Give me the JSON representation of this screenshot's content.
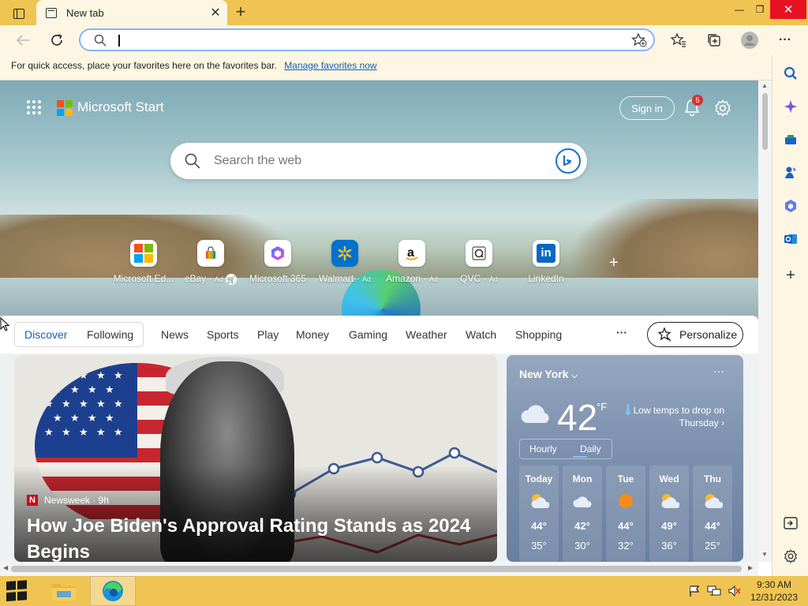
{
  "browser": {
    "tab_title": "New tab",
    "address_value": "",
    "favorites_bar_text": "For quick access, place your favorites here on the favorites bar.",
    "favorites_bar_link": "Manage favorites now"
  },
  "page": {
    "brand": "Microsoft Start",
    "sign_in": "Sign in",
    "notification_count": "5",
    "search_placeholder": "Search the web",
    "quick_links": [
      {
        "label": "Microsoft Ed...",
        "ad": "",
        "icon": "microsoft-logo-icon"
      },
      {
        "label": "eBay",
        "ad": "Ad",
        "icon": "ebay-bag-icon"
      },
      {
        "label": "Microsoft 365",
        "ad": "",
        "icon": "microsoft-365-icon"
      },
      {
        "label": "Walmart",
        "ad": "Ad",
        "icon": "walmart-icon"
      },
      {
        "label": "Amazon",
        "ad": "Ad",
        "icon": "amazon-icon"
      },
      {
        "label": "QVC",
        "ad": "Ad",
        "icon": "qvc-icon"
      },
      {
        "label": "LinkedIn",
        "ad": "",
        "icon": "linkedin-icon"
      }
    ],
    "nav": [
      "Discover",
      "Following",
      "News",
      "Sports",
      "Play",
      "Money",
      "Gaming",
      "Weather",
      "Watch",
      "Shopping"
    ],
    "nav_more": "···",
    "personalize": "Personalize"
  },
  "news": {
    "source": "Newsweek · 9h",
    "headline": "How Joe Biden's Approval Rating Stands as 2024 Begins"
  },
  "weather": {
    "city": "New York",
    "temp": "42",
    "unit": "°F",
    "note": "Low temps to drop on Thursday",
    "tabs": [
      "Hourly",
      "Daily"
    ],
    "days": [
      {
        "name": "Today",
        "hi": "44°",
        "lo": "35°",
        "icon": "partly-cloudy-icon"
      },
      {
        "name": "Mon",
        "hi": "42°",
        "lo": "30°",
        "icon": "cloudy-icon"
      },
      {
        "name": "Tue",
        "hi": "44°",
        "lo": "32°",
        "icon": "sunny-icon"
      },
      {
        "name": "Wed",
        "hi": "49°",
        "lo": "36°",
        "icon": "partly-cloudy-icon"
      },
      {
        "name": "Thu",
        "hi": "44°",
        "lo": "25°",
        "icon": "partly-cloudy-icon"
      }
    ]
  },
  "taskbar": {
    "time": "9:30 AM",
    "date": "12/31/2023"
  },
  "colors": {
    "chrome": "#f0c453",
    "accent": "#1a5fb4",
    "close": "#e81123"
  }
}
